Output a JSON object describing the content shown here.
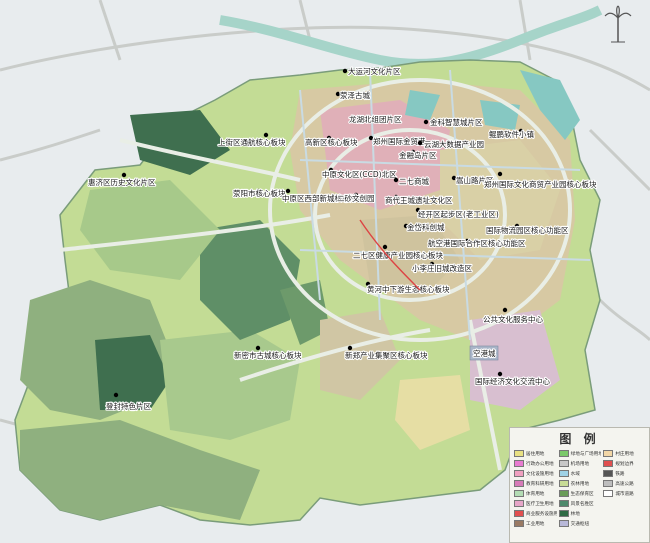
{
  "district_labels": [
    "大运河文化片区",
    "荥泽古城",
    "龙湖北组团片区",
    "金科智慧城片区",
    "高新区核心板块",
    "郑州国际金贸港",
    "上街区通航核心板块",
    "云湖大数据产业园",
    "鲲鹏软件小镇",
    "金融岛片区",
    "惠济区历史文化片区",
    "中原文化区(CCD)北区",
    "二七商城",
    "嵩山路片区",
    "郑州国际文化商贸产业园核心板块",
    "荥阳市核心板块",
    "中原区西部新城核心片区",
    "二砂文创园",
    "商代王城遗址文化区",
    "经开区起步区(老工业区)",
    "金岱科创城",
    "国际物流园区核心功能区",
    "二七区健康产业园核心板块",
    "航空港国际合作区核心功能区",
    "小李庄旧城改造区",
    "黄河中下游生态核心板块",
    "公共文化服务中心",
    "新密市古城核心板块",
    "新郑产业集聚区核心板块",
    "空港城",
    "国际经济文化交流中心",
    "登封特色片区"
  ],
  "legend": {
    "title": "图 例",
    "items": [
      {
        "label": "居住用地",
        "color": "#e9e183"
      },
      {
        "label": "绿地与广场用地",
        "color": "#7bc96a"
      },
      {
        "label": "村庄用地",
        "color": "#f2d6a6"
      },
      {
        "label": "行政办公用地",
        "color": "#e87bd0"
      },
      {
        "label": "机场用地",
        "color": "#c7c7c7"
      },
      {
        "label": "规划边界",
        "color": "#e05050"
      },
      {
        "label": "文化设施用地",
        "color": "#f0a0c0"
      },
      {
        "label": "水域",
        "color": "#9fd2e6"
      },
      {
        "label": "铁路",
        "color": "#555555"
      },
      {
        "label": "教育科研用地",
        "color": "#d77bb8"
      },
      {
        "label": "农林用地",
        "color": "#c8dc96"
      },
      {
        "label": "高速公路",
        "color": "#bdbdbd"
      },
      {
        "label": "体育用地",
        "color": "#b4dcb4"
      },
      {
        "label": "生态保育区",
        "color": "#6a9c58"
      },
      {
        "label": "城市道路",
        "color": "#ffffff"
      },
      {
        "label": "医疗卫生用地",
        "color": "#e7a6c8"
      },
      {
        "label": "风景名胜区",
        "color": "#4e8a6c"
      },
      {
        "label": "",
        "color": ""
      },
      {
        "label": "商业服务设施用地",
        "color": "#e25050"
      },
      {
        "label": "林地",
        "color": "#2f6b44"
      },
      {
        "label": "",
        "color": ""
      },
      {
        "label": "工业用地",
        "color": "#9a7a64"
      },
      {
        "label": "交通枢纽",
        "color": "#b8b8d8"
      },
      {
        "label": "",
        "color": ""
      }
    ]
  },
  "colors": {
    "background": "#e8ecee",
    "boundary_fill": "#bcd98a",
    "dark_green": "#5f8f67",
    "mid_green": "#8fb07f",
    "light_green": "#c7dd9a",
    "urban": "#d8d0b2",
    "water": "#86c8c2"
  }
}
